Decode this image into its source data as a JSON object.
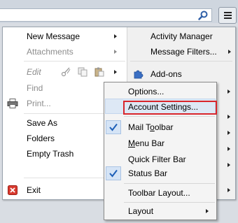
{
  "menu": {
    "left": {
      "new_message": "New Message",
      "attachments": "Attachments",
      "edit": "Edit",
      "find": "Find",
      "print": "Print...",
      "save_as": "Save As",
      "folders": "Folders",
      "empty_trash": "Empty Trash",
      "exit": "Exit"
    },
    "right": {
      "activity_manager": "Activity Manager",
      "message_filters": "Message Filters...",
      "add_ons": "Add-ons"
    }
  },
  "submenu": {
    "options": "Options...",
    "account_settings": "Account Settings...",
    "mail_toolbar": "Mail Toolbar",
    "menu_bar": "Menu Bar",
    "quick_filter_bar": "Quick Filter Bar",
    "status_bar": "Status Bar",
    "toolbar_layout": "Toolbar Layout...",
    "layout": "Layout"
  },
  "colors": {
    "highlight_border": "#d9252b",
    "checked_bg": "#d5e4f6",
    "addons_icon": "#3a6fc4"
  },
  "icons": [
    "search-icon",
    "hamburger-icon",
    "cut-icon",
    "copy-icon",
    "paste-icon",
    "printer-icon",
    "puzzle-icon",
    "exit-icon",
    "checkmark-icon",
    "arrow-right-icon"
  ]
}
